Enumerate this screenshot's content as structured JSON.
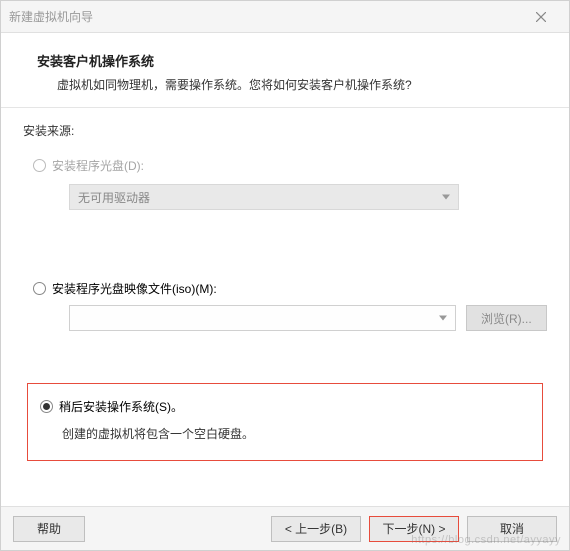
{
  "window": {
    "title": "新建虚拟机向导"
  },
  "header": {
    "heading": "安装客户机操作系统",
    "subtitle": "虚拟机如同物理机，需要操作系统。您将如何安装客户机操作系统?"
  },
  "source": {
    "label": "安装来源:",
    "opt1": {
      "label": "安装程序光盘(D):",
      "dropdown": "无可用驱动器"
    },
    "opt2": {
      "label": "安装程序光盘映像文件(iso)(M):",
      "browse": "浏览(R)..."
    },
    "opt3": {
      "label": "稍后安装操作系统(S)。",
      "desc": "创建的虚拟机将包含一个空白硬盘。"
    }
  },
  "footer": {
    "help": "帮助",
    "back": "< 上一步(B)",
    "next": "下一步(N) >",
    "cancel": "取消"
  },
  "watermark": "https://blog.csdn.net/ayyayy"
}
